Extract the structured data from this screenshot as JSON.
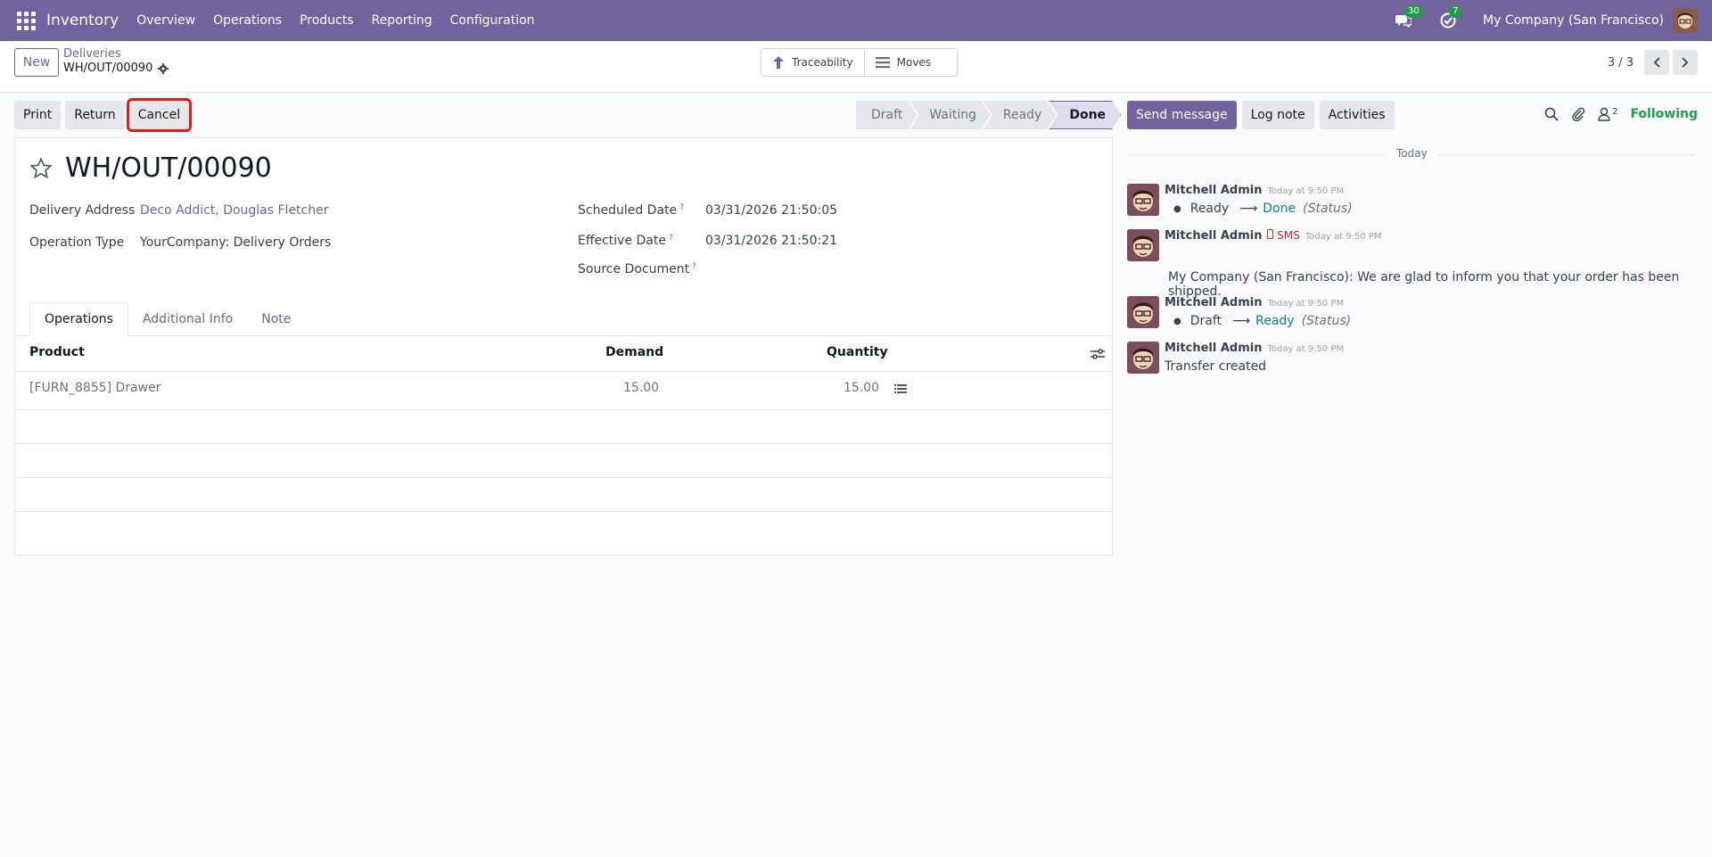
{
  "navbar": {
    "brand": "Inventory",
    "menu": [
      "Overview",
      "Operations",
      "Products",
      "Reporting",
      "Configuration"
    ],
    "messages_badge": "30",
    "activities_badge": "7",
    "company": "My Company (San Francisco)"
  },
  "control_panel": {
    "new_label": "New",
    "breadcrumb_parent": "Deliveries",
    "breadcrumb_current": "WH/OUT/00090",
    "smart_buttons": [
      "Traceability",
      "Moves"
    ],
    "pager": "3 / 3"
  },
  "actions": {
    "print": "Print",
    "return": "Return",
    "cancel": "Cancel"
  },
  "statusbar": [
    "Draft",
    "Waiting",
    "Ready",
    "Done"
  ],
  "form": {
    "title": "WH/OUT/00090",
    "delivery_address_label": "Delivery Address",
    "delivery_address": "Deco Addict, Douglas Fletcher",
    "operation_type_label": "Operation Type",
    "operation_type": "YourCompany: Delivery Orders",
    "scheduled_date_label": "Scheduled Date",
    "scheduled_date": "03/31/2026 21:50:05",
    "effective_date_label": "Effective Date",
    "effective_date": "03/31/2026 21:50:21",
    "source_document_label": "Source Document",
    "help_mark": "?",
    "tabs": [
      "Operations",
      "Additional Info",
      "Note"
    ],
    "columns": {
      "product": "Product",
      "demand": "Demand",
      "quantity": "Quantity"
    },
    "rows": [
      {
        "product": "[FURN_8855] Drawer",
        "demand": "15.00",
        "quantity": "15.00"
      }
    ]
  },
  "chatter": {
    "send_message": "Send message",
    "log_note": "Log note",
    "activities": "Activities",
    "followers_count": "2",
    "following": "Following",
    "day_label": "Today",
    "arrow": "⟶",
    "messages": [
      {
        "author": "Mitchell Admin",
        "date": "Today at 9:50 PM",
        "old": "Ready",
        "new": "Done",
        "field": "(Status)"
      },
      {
        "author": "Mitchell Admin",
        "sms": "SMS",
        "date": "Today at 9:50 PM",
        "body": "My Company (San Francisco): We are glad to inform you that your order has been shipped."
      },
      {
        "author": "Mitchell Admin",
        "date": "Today at 9:50 PM",
        "old": "Draft",
        "new": "Ready",
        "field": "(Status)"
      },
      {
        "author": "Mitchell Admin",
        "date": "Today at 9:50 PM",
        "body": "Transfer created"
      }
    ]
  },
  "colors": {
    "brand": "#71639e",
    "following": "#1f9e4a",
    "highlight": "#e11d1d"
  }
}
